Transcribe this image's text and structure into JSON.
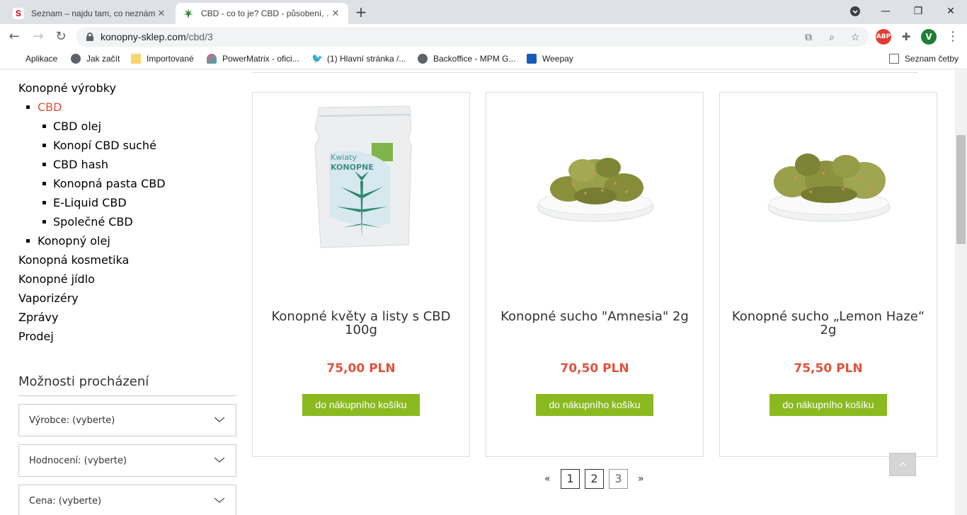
{
  "browser": {
    "tabs": [
      {
        "title": "Seznam – najdu tam, co neznám",
        "favicon": "seznam-s-icon",
        "active": false
      },
      {
        "title": "CBD - co to je? CBD - působení, …",
        "favicon": "cannabis-leaf-icon",
        "active": true
      }
    ],
    "url_host": "konopny-sklep.com",
    "url_path": "/cbd/3",
    "profile_initial": "V",
    "abp_label": "ABP",
    "bookmarks": [
      {
        "label": "Aplikace",
        "icon": "apps-grid-icon"
      },
      {
        "label": "Jak začít",
        "icon": "globe-icon"
      },
      {
        "label": "Importované",
        "icon": "folder-icon"
      },
      {
        "label": "PowerMatrix - ofici...",
        "icon": "powermatrix-icon"
      },
      {
        "label": "(1) Hlavní stránka /...",
        "icon": "twitter-icon"
      },
      {
        "label": "Backoffice - MPM G...",
        "icon": "globe-icon"
      },
      {
        "label": "Weepay",
        "icon": "weepay-icon"
      }
    ],
    "reading_list": "Seznam četby"
  },
  "sidebar": {
    "categories": [
      {
        "label": "Konopné výrobky",
        "level": 1
      },
      {
        "label": "CBD",
        "level": 2,
        "active": true
      },
      {
        "label": "CBD olej",
        "level": 3
      },
      {
        "label": "Konopí CBD suché",
        "level": 3
      },
      {
        "label": "CBD hash",
        "level": 3
      },
      {
        "label": "Konopná pasta CBD",
        "level": 3
      },
      {
        "label": "E-Liquid CBD",
        "level": 3
      },
      {
        "label": "Společné CBD",
        "level": 3
      },
      {
        "label": "Konopný olej",
        "level": 2
      },
      {
        "label": "Konopná kosmetika",
        "level": 1
      },
      {
        "label": "Konopné jídlo",
        "level": 1
      },
      {
        "label": "Vaporizéry",
        "level": 1
      },
      {
        "label": "Zprávy",
        "level": 1
      },
      {
        "label": "Prodej",
        "level": 1
      }
    ],
    "browse_title": "Možnosti procházení",
    "filters": [
      {
        "label": "Výrobce: (vyberte)"
      },
      {
        "label": "Hodnocení: (vyberte)"
      },
      {
        "label": "Cena: (vyberte)"
      }
    ]
  },
  "products": [
    {
      "name": "Konopné květy a listy s CBD 100g",
      "price": "75,00 PLN",
      "button": "do nákupního košíku",
      "image": "cbd-bag-image"
    },
    {
      "name": "Konopné sucho \"Amnesia\" 2g",
      "price": "70,50 PLN",
      "button": "do nákupního košíku",
      "image": "dried-buds-dish-image"
    },
    {
      "name": "Konopné sucho „Lemon Haze“ 2g",
      "price": "75,50 PLN",
      "button": "do nákupního košíku",
      "image": "dried-buds-dish-image"
    }
  ],
  "pagination": {
    "prev": "«",
    "pages": [
      "1",
      "2",
      "3"
    ],
    "current": "3",
    "next": "»"
  },
  "colors": {
    "accent_red": "#e0533d",
    "button_green": "#8ab920"
  }
}
